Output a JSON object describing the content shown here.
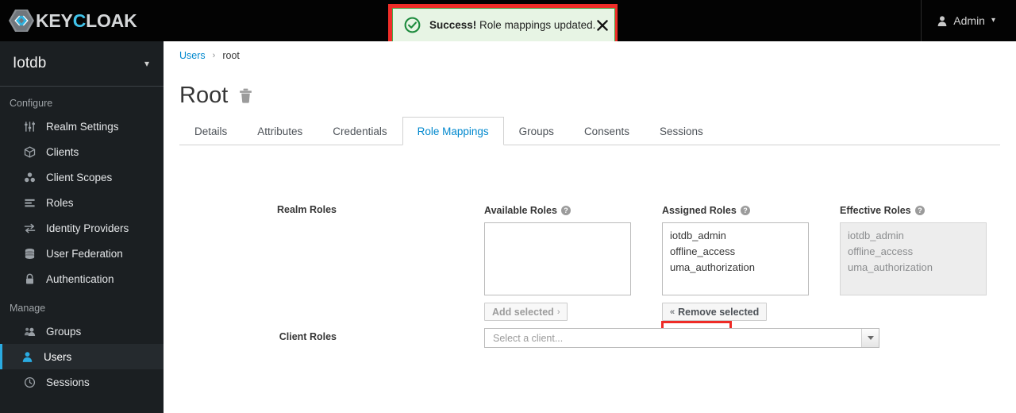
{
  "topbar": {
    "brand_key": "KEY",
    "brand_c": "C",
    "brand_loak": "LOAK",
    "logo_icon": "keycloak-hexagon-logo",
    "user_icon": "user-icon",
    "user_label": "Admin",
    "caret_icon": "chevron-down-icon"
  },
  "alert": {
    "icon": "check-circle-icon",
    "strong": "Success!",
    "message": " Role mappings updated.",
    "close_icon": "close-icon",
    "background": "#e7f4e4",
    "border_color": "#4ca64c",
    "highlight_color": "#ef2d28"
  },
  "sidebar": {
    "realm": {
      "name": "Iotdb",
      "caret_icon": "chevron-down-icon"
    },
    "sections": [
      {
        "title": "Configure",
        "items": [
          {
            "label": "Realm Settings",
            "icon": "sliders-icon",
            "active": false
          },
          {
            "label": "Clients",
            "icon": "cube-icon",
            "active": false
          },
          {
            "label": "Client Scopes",
            "icon": "cubes-icon",
            "active": false
          },
          {
            "label": "Roles",
            "icon": "list-lines-icon",
            "active": false
          },
          {
            "label": "Identity Providers",
            "icon": "exchange-arrows-icon",
            "active": false
          },
          {
            "label": "User Federation",
            "icon": "database-icon",
            "active": false
          },
          {
            "label": "Authentication",
            "icon": "lock-icon",
            "active": false
          }
        ]
      },
      {
        "title": "Manage",
        "items": [
          {
            "label": "Groups",
            "icon": "users-group-icon",
            "active": false
          },
          {
            "label": "Users",
            "icon": "user-icon",
            "active": true
          },
          {
            "label": "Sessions",
            "icon": "clock-icon",
            "active": false
          }
        ]
      }
    ],
    "active_color": "#2aabe2"
  },
  "main": {
    "breadcrumb": {
      "link": "Users",
      "separator": "›",
      "current": "root"
    },
    "page_title": "Root",
    "delete_icon": "trash-icon",
    "tabs": [
      {
        "label": "Details",
        "active": false
      },
      {
        "label": "Attributes",
        "active": false
      },
      {
        "label": "Credentials",
        "active": false
      },
      {
        "label": "Role Mappings",
        "active": true
      },
      {
        "label": "Groups",
        "active": false
      },
      {
        "label": "Consents",
        "active": false
      },
      {
        "label": "Sessions",
        "active": false
      }
    ],
    "active_tab_color": "#0088ce",
    "form": {
      "realm_roles_label": "Realm Roles",
      "client_roles_label": "Client Roles",
      "available": {
        "title": "Available Roles",
        "help_icon": "help-circle-icon",
        "options": [],
        "button": {
          "label": "Add selected",
          "chevron": "›",
          "disabled": true
        }
      },
      "assigned": {
        "title": "Assigned Roles",
        "help_icon": "help-circle-icon",
        "options": [
          "iotdb_admin",
          "offline_access",
          "uma_authorization"
        ],
        "button": {
          "chevron": "«",
          "label": "Remove selected",
          "disabled": false
        },
        "highlighted_option": "iotdb_admin"
      },
      "effective": {
        "title": "Effective Roles",
        "help_icon": "help-circle-icon",
        "options": [
          "iotdb_admin",
          "offline_access",
          "uma_authorization"
        ],
        "disabled": true
      },
      "client_select": {
        "placeholder": "Select a client...",
        "arrow_icon": "triangle-down-icon"
      }
    }
  }
}
